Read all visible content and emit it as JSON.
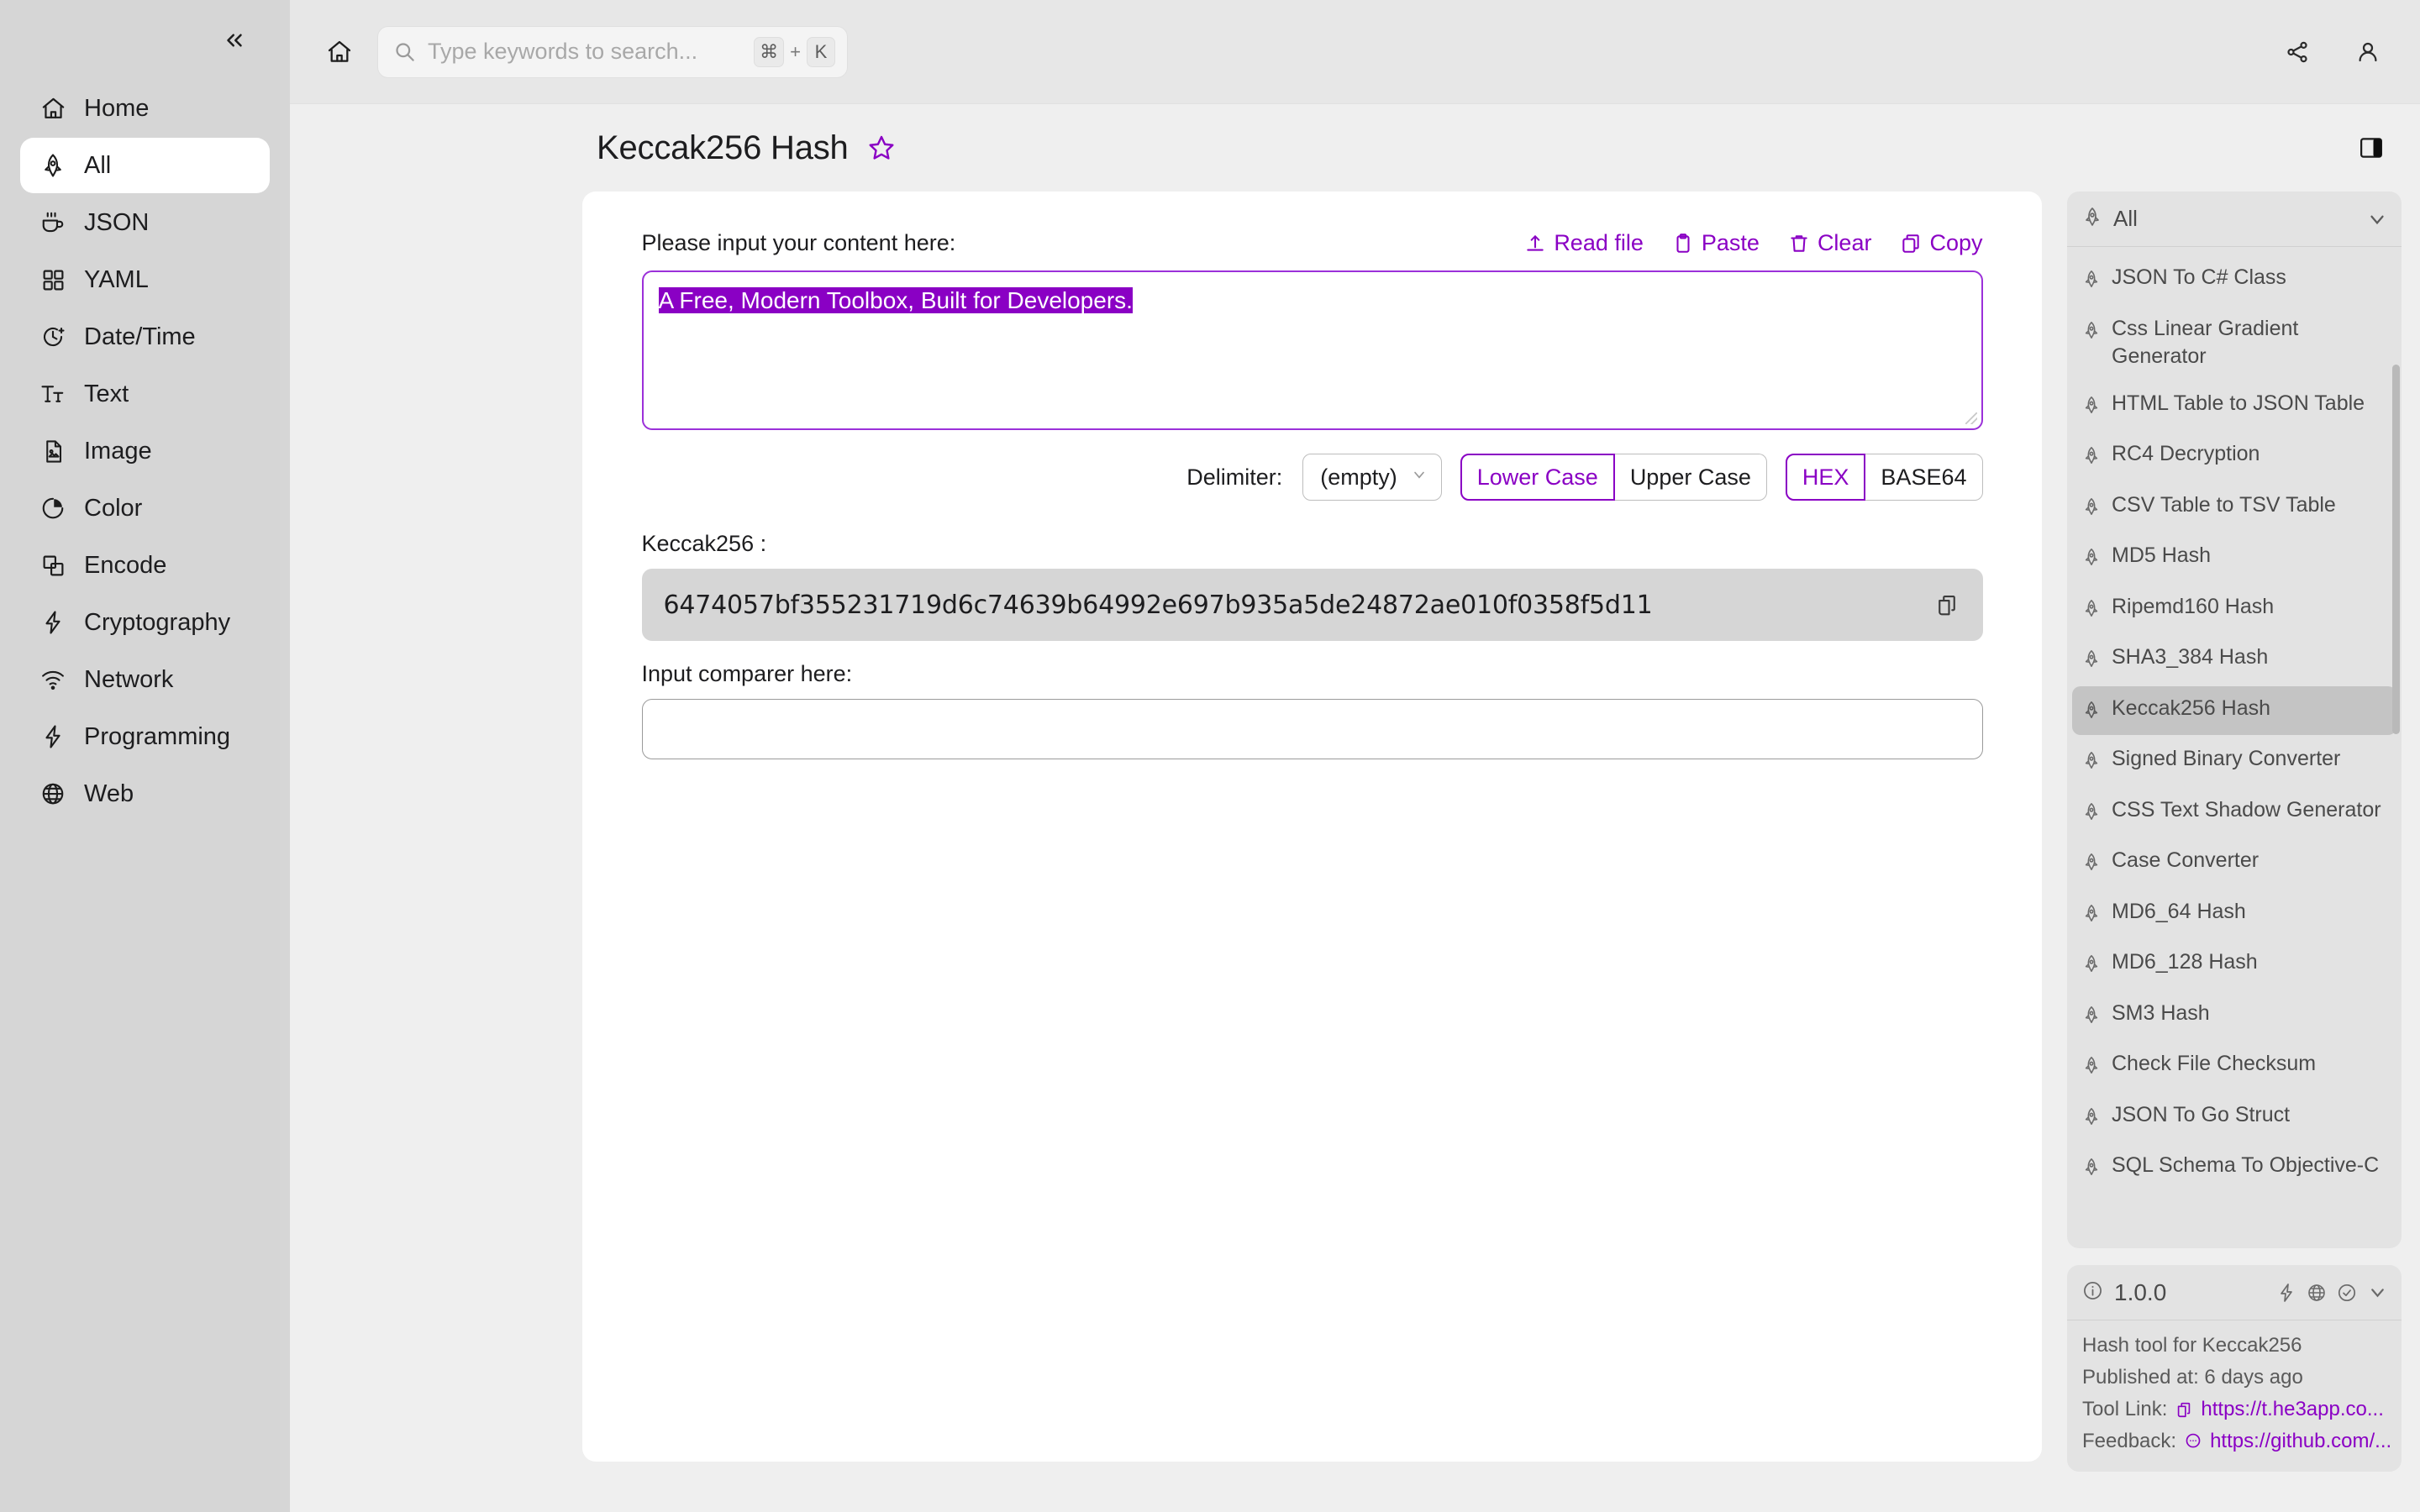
{
  "sidebar": {
    "collapse_icon": "chevrons-left-icon",
    "items": [
      {
        "label": "Home",
        "icon": "home-icon",
        "active": false
      },
      {
        "label": "All",
        "icon": "rocket-icon",
        "active": true
      },
      {
        "label": "JSON",
        "icon": "coffee-icon",
        "active": false
      },
      {
        "label": "YAML",
        "icon": "grid-icon",
        "active": false
      },
      {
        "label": "Date/Time",
        "icon": "clock-icon",
        "active": false
      },
      {
        "label": "Text",
        "icon": "text-icon",
        "active": false
      },
      {
        "label": "Image",
        "icon": "image-file-icon",
        "active": false
      },
      {
        "label": "Color",
        "icon": "pie-chart-icon",
        "active": false
      },
      {
        "label": "Encode",
        "icon": "layers-icon",
        "active": false
      },
      {
        "label": "Cryptography",
        "icon": "bolt-icon",
        "active": false
      },
      {
        "label": "Network",
        "icon": "wifi-icon",
        "active": false
      },
      {
        "label": "Programming",
        "icon": "bolt-icon",
        "active": false
      },
      {
        "label": "Web",
        "icon": "globe-icon",
        "active": false
      }
    ]
  },
  "topbar": {
    "home_icon": "home-icon",
    "search": {
      "icon": "search-icon",
      "placeholder": "Type keywords to search...",
      "value": "",
      "kbd_cmd": "⌘",
      "kbd_plus": "+",
      "kbd_key": "K"
    },
    "share_icon": "share-icon",
    "account_icon": "user-icon"
  },
  "header": {
    "title": "Keccak256 Hash",
    "favorite_icon": "star-icon",
    "panel_toggle_icon": "panel-right-icon"
  },
  "tool": {
    "input_label": "Please input your content here:",
    "actions": [
      {
        "label": "Read file",
        "icon": "upload-icon"
      },
      {
        "label": "Paste",
        "icon": "clipboard-paste-icon"
      },
      {
        "label": "Clear",
        "icon": "trash-icon"
      },
      {
        "label": "Copy",
        "icon": "copy-icon"
      }
    ],
    "input_value": "A Free, Modern Toolbox, Built for Developers.",
    "delimiter_label": "Delimiter:",
    "delimiter_value": "(empty)",
    "case_options": [
      {
        "label": "Lower Case",
        "selected": true
      },
      {
        "label": "Upper Case",
        "selected": false
      }
    ],
    "encoding_options": [
      {
        "label": "HEX",
        "selected": true
      },
      {
        "label": "BASE64",
        "selected": false
      }
    ],
    "output_label": "Keccak256 :",
    "output_value": "6474057bf355231719d6c74639b64992e697b935a5de24872ae010f0358f5d11",
    "output_copy_icon": "copy-icon",
    "comparer_label": "Input comparer here:",
    "comparer_value": "",
    "comparer_placeholder": ""
  },
  "rightpanel": {
    "filter": {
      "label": "All",
      "icon": "rocket-icon",
      "chevron": "chevron-down-icon"
    },
    "tools": [
      {
        "label": "JSON To C# Class",
        "selected": false
      },
      {
        "label": "Css Linear Gradient Generator",
        "selected": false
      },
      {
        "label": "HTML Table to JSON Table",
        "selected": false
      },
      {
        "label": "RC4 Decryption",
        "selected": false
      },
      {
        "label": "CSV Table to TSV Table",
        "selected": false
      },
      {
        "label": "MD5 Hash",
        "selected": false
      },
      {
        "label": "Ripemd160 Hash",
        "selected": false
      },
      {
        "label": "SHA3_384 Hash",
        "selected": false
      },
      {
        "label": "Keccak256 Hash",
        "selected": true
      },
      {
        "label": "Signed Binary Converter",
        "selected": false
      },
      {
        "label": "CSS Text Shadow Generator",
        "selected": false
      },
      {
        "label": "Case Converter",
        "selected": false
      },
      {
        "label": "MD6_64 Hash",
        "selected": false
      },
      {
        "label": "MD6_128 Hash",
        "selected": false
      },
      {
        "label": "SM3 Hash",
        "selected": false
      },
      {
        "label": "Check File Checksum",
        "selected": false
      },
      {
        "label": "JSON To Go Struct",
        "selected": false
      },
      {
        "label": "SQL Schema To Objective-C",
        "selected": false
      }
    ],
    "info": {
      "version": "1.0.0",
      "info_icon": "info-circle-icon",
      "icons": [
        "bolt-icon",
        "globe-icon",
        "check-circle-icon",
        "chevron-down-icon"
      ],
      "description": "Hash tool for Keccak256",
      "published": "Published at: 6 days ago",
      "tool_link_label": "Tool Link:",
      "tool_link_value": "https://t.he3app.co...",
      "feedback_label": "Feedback:",
      "feedback_value": "https://github.com/..."
    }
  },
  "colors": {
    "accent": "#8A00C4",
    "sidebar_bg": "#d6d6d6",
    "panel_bg": "#e3e3e3",
    "canvas_bg": "#efefef"
  }
}
